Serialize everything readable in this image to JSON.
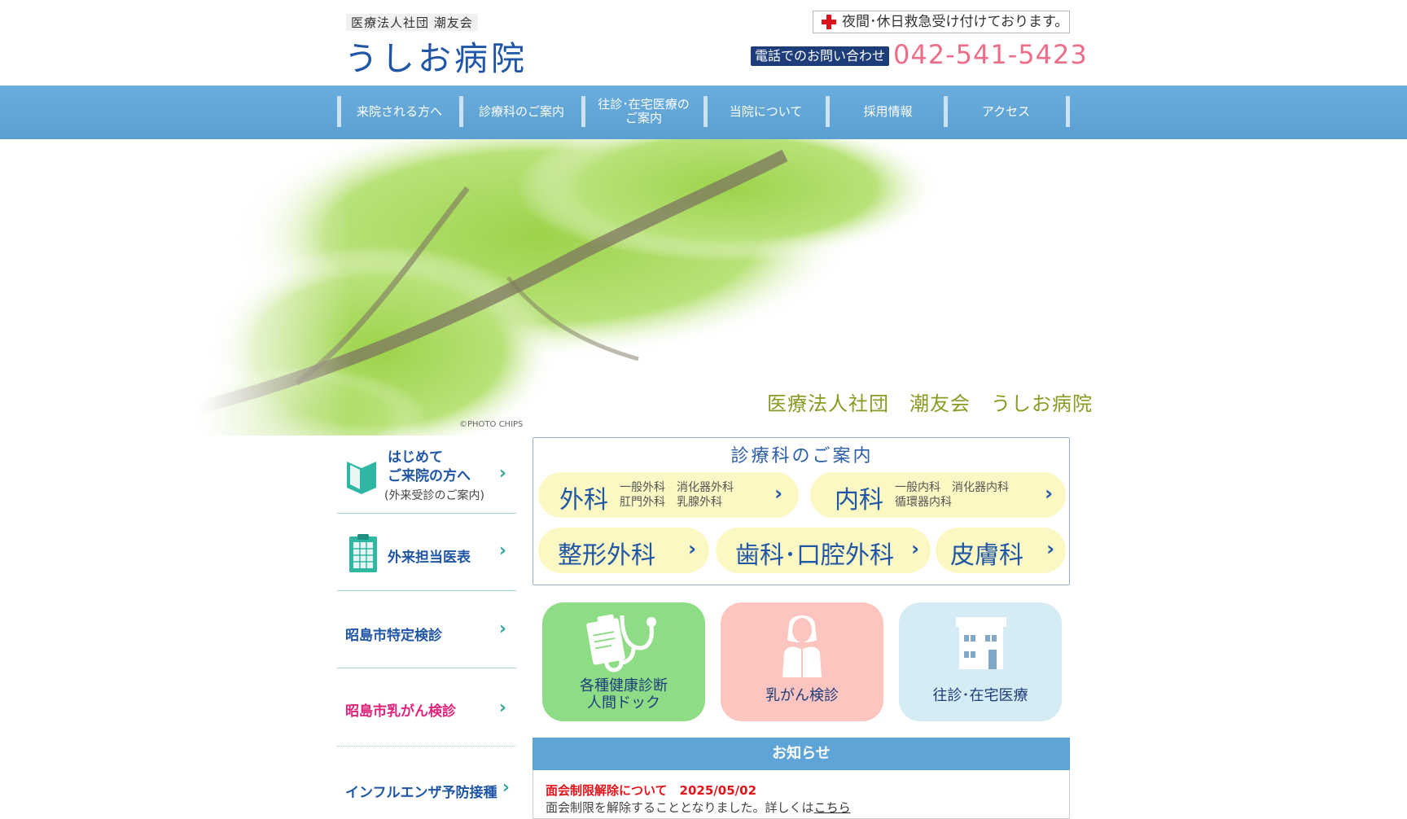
{
  "header": {
    "org_name": "医療法人社団  潮友会",
    "hospital_name": "うしお病院",
    "night_notice": "夜間･休日救急受け付けております。",
    "tel_label": "電話でのお問い合わせ",
    "tel_number": "042-541-5423"
  },
  "nav": {
    "items": [
      {
        "label": "来院される方へ"
      },
      {
        "label": "診療科のご案内"
      },
      {
        "label": "往診･在宅医療の\nご案内"
      },
      {
        "label": "当院について"
      },
      {
        "label": "採用情報"
      },
      {
        "label": "アクセス"
      }
    ]
  },
  "hero": {
    "caption": "医療法人社団　潮友会　うしお病院",
    "photo_credit": "©PHOTO CHIPS"
  },
  "sidebar": {
    "first_visit_line1": "はじめて",
    "first_visit_line2": "ご来院の方へ",
    "first_visit_sub": "(外来受診のご案内)",
    "schedule": "外来担当医表",
    "checkup": "昭島市特定検診",
    "breast": "昭島市乳がん検診",
    "flu": "インフルエンザ予防接種",
    "chevron": "›"
  },
  "departments": {
    "title": "診療科のご案内",
    "surgery": {
      "name": "外科",
      "sub1": "一般外科　消化器外科",
      "sub2": "肛門外科　乳腺外科"
    },
    "internal": {
      "name": "内科",
      "sub1": "一般内科　消化器内科",
      "sub2": "循環器内科"
    },
    "ortho": {
      "name": "整形外科"
    },
    "dental": {
      "name": "歯科･口腔外科"
    },
    "derm": {
      "name": "皮膚科"
    }
  },
  "cards": {
    "checkup_line1": "各種健康診断",
    "checkup_line2": "人間ドック",
    "breast": "乳がん検診",
    "home": "往診･在宅医療"
  },
  "news": {
    "heading": "お知らせ",
    "item_title": "面会制限解除について　2025/05/02",
    "item_text": "面会制限を解除することとなりました。詳しくは",
    "item_link": "こちら"
  },
  "colors": {
    "brand_blue": "#1f56a6",
    "nav_blue": "#5b9fd2",
    "tel_pink": "#ee6d88",
    "news_red": "#e0141a",
    "breast_pink": "#e0237b"
  }
}
